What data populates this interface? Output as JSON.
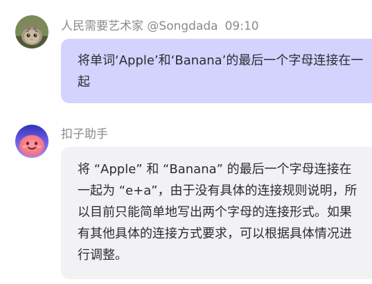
{
  "messages": [
    {
      "sender": "人民需要艺术家 @Songdada",
      "time": "09:10",
      "avatar_icon": "cat-avatar-icon",
      "text": "将单词‘Apple’和‘Banana’的最后一个字母连接在一起"
    },
    {
      "sender": "扣子助手",
      "avatar_icon": "smiley-assistant-avatar-icon",
      "text": "将 “Apple” 和 “Banana” 的最后一个字母连接在一起为 “e+a”，由于没有具体的连接规则说明，所以目前只能简单地写出两个字母的连接形式。如果有其他具体的连接方式要求，可以根据具体情况进行调整。"
    }
  ],
  "colors": {
    "user_bubble": "#d3d3fd",
    "bot_bubble": "#f2f2f4",
    "meta_text": "#8a8a8f",
    "body_text": "#2b2b33"
  }
}
